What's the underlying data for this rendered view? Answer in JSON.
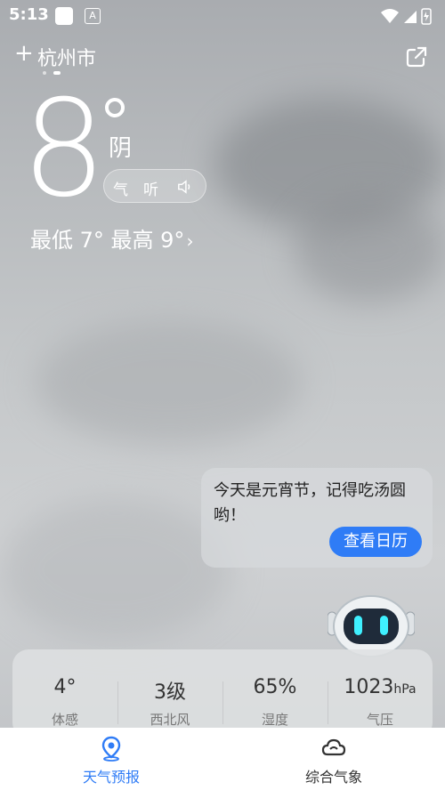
{
  "status_bar": {
    "time": "5:13",
    "app_icon": "A"
  },
  "header": {
    "add_icon": "+",
    "city": "杭州市",
    "share_icon": "share-icon"
  },
  "current": {
    "temperature": "8",
    "condition": "阴",
    "listen_label_1": "气",
    "listen_label_2": "听",
    "minmax": "最低 7°  最高 9°",
    "minmax_chevron": "›"
  },
  "tip": {
    "message": "今天是元宵节，记得吃汤圆哟！",
    "button": "查看日历"
  },
  "stats": [
    {
      "value": "4°",
      "unit": "",
      "label": "体感"
    },
    {
      "value": "3级",
      "unit": "",
      "label": "西北风"
    },
    {
      "value": "65%",
      "unit": "",
      "label": "湿度"
    },
    {
      "value": "1023",
      "unit": "hPa",
      "label": "气压"
    }
  ],
  "nav": {
    "tab1": "天气预报",
    "tab2": "综合气象",
    "active_color": "#2f7cf6"
  },
  "colors": {
    "accent": "#2f7cf6"
  }
}
